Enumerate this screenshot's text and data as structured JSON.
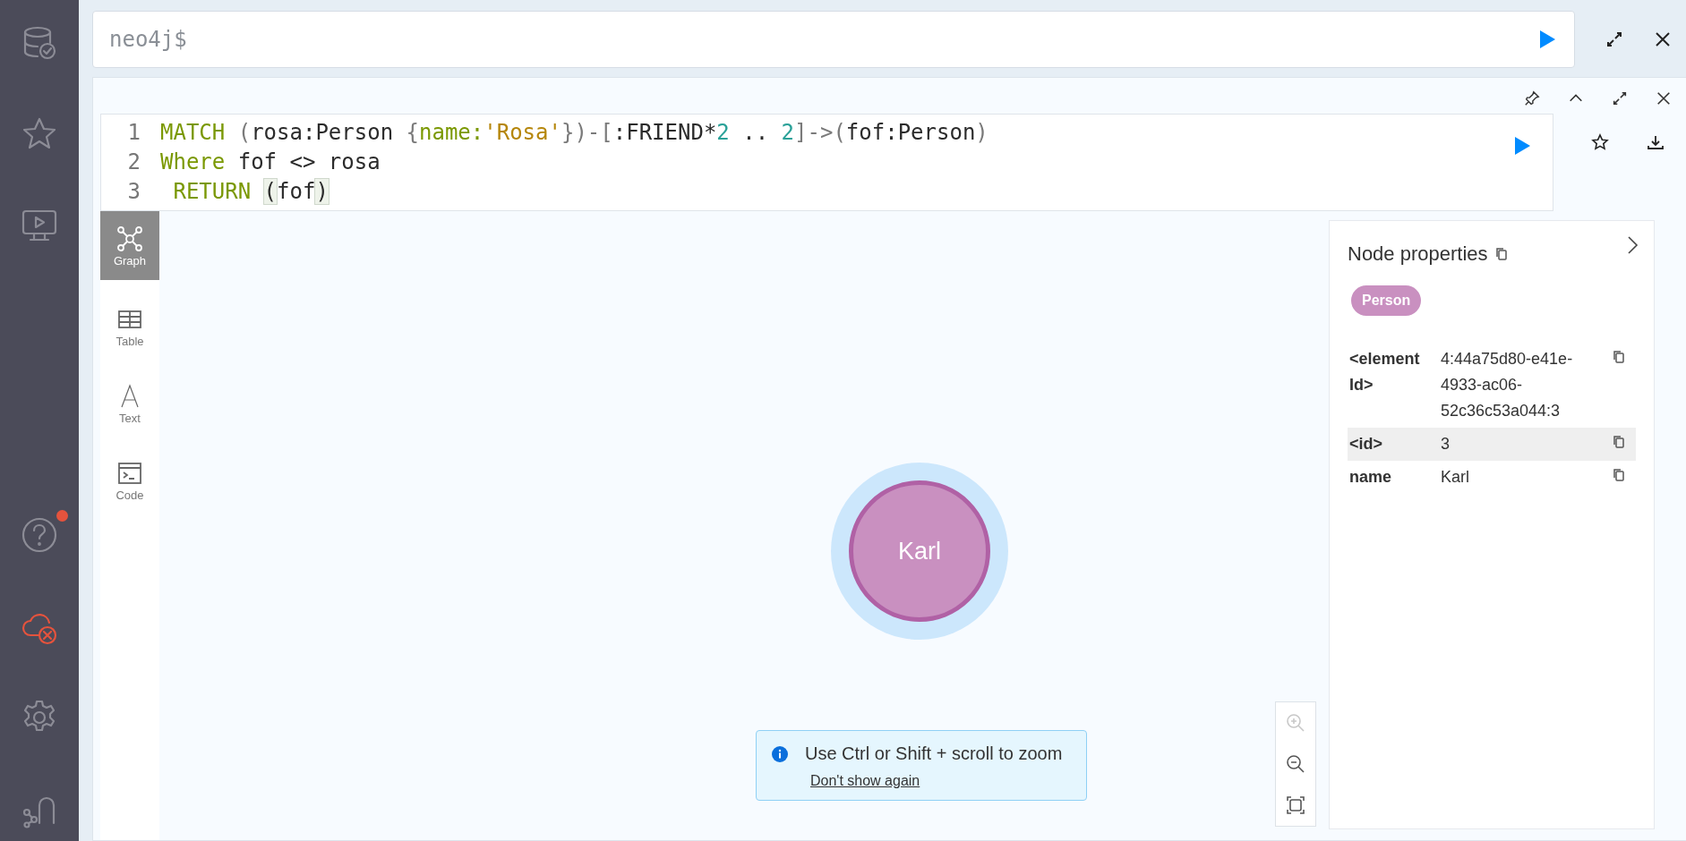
{
  "sidebar": {
    "items": [
      {
        "kind": "database",
        "error": false
      },
      {
        "kind": "favorites",
        "error": false
      },
      {
        "kind": "guides",
        "error": false
      },
      {
        "kind": "help",
        "notification": true,
        "error": false
      },
      {
        "kind": "cloud",
        "error": true
      },
      {
        "kind": "settings",
        "error": false
      },
      {
        "kind": "integrations",
        "error": false
      }
    ]
  },
  "command_bar": {
    "prompt": "neo4j$"
  },
  "query": {
    "lines": [
      {
        "number": "1",
        "tokens": [
          {
            "text": "MATCH",
            "kind": "keyword"
          },
          {
            "text": " (",
            "kind": "punct"
          },
          {
            "text": "rosa:Person ",
            "kind": "plain"
          },
          {
            "text": "{",
            "kind": "punct"
          },
          {
            "text": "name:",
            "kind": "property"
          },
          {
            "text": "'Rosa'",
            "kind": "string"
          },
          {
            "text": "})-[",
            "kind": "punct"
          },
          {
            "text": ":FRIEND*",
            "kind": "plain"
          },
          {
            "text": "2",
            "kind": "number"
          },
          {
            "text": " .. ",
            "kind": "plain"
          },
          {
            "text": "2",
            "kind": "number"
          },
          {
            "text": "]->(",
            "kind": "punct"
          },
          {
            "text": "fof:Person",
            "kind": "plain"
          },
          {
            "text": ")",
            "kind": "punct"
          }
        ]
      },
      {
        "number": "2",
        "tokens": [
          {
            "text": "Where",
            "kind": "keyword"
          },
          {
            "text": " fof <> rosa",
            "kind": "plain"
          }
        ]
      },
      {
        "number": "3",
        "tokens": [
          {
            "text": " RETURN ",
            "kind": "keyword"
          },
          {
            "text": "(",
            "kind": "matched"
          },
          {
            "text": "fof",
            "kind": "plain"
          },
          {
            "text": ")",
            "kind": "matched"
          }
        ]
      }
    ]
  },
  "views": [
    {
      "label": "Graph",
      "selected": true
    },
    {
      "label": "Table",
      "selected": false
    },
    {
      "label": "Text",
      "selected": false
    },
    {
      "label": "Code",
      "selected": false
    }
  ],
  "graph": {
    "nodes": [
      {
        "caption": "Karl",
        "color": "#c990c0",
        "selected": true
      }
    ]
  },
  "properties": {
    "title": "Node properties",
    "labels": [
      {
        "text": "Person",
        "color": "#c990c0"
      }
    ],
    "rows": [
      {
        "key": "<element Id>",
        "value": "4:44a75d80-e41e-4933-ac06-52c36c53a044:3",
        "highlighted": false
      },
      {
        "key": "<id>",
        "value": "3",
        "highlighted": true
      },
      {
        "key": "name",
        "value": "Karl",
        "highlighted": false
      }
    ]
  },
  "toast": {
    "message": "Use Ctrl or Shift + scroll to zoom",
    "link": "Don't show again"
  }
}
